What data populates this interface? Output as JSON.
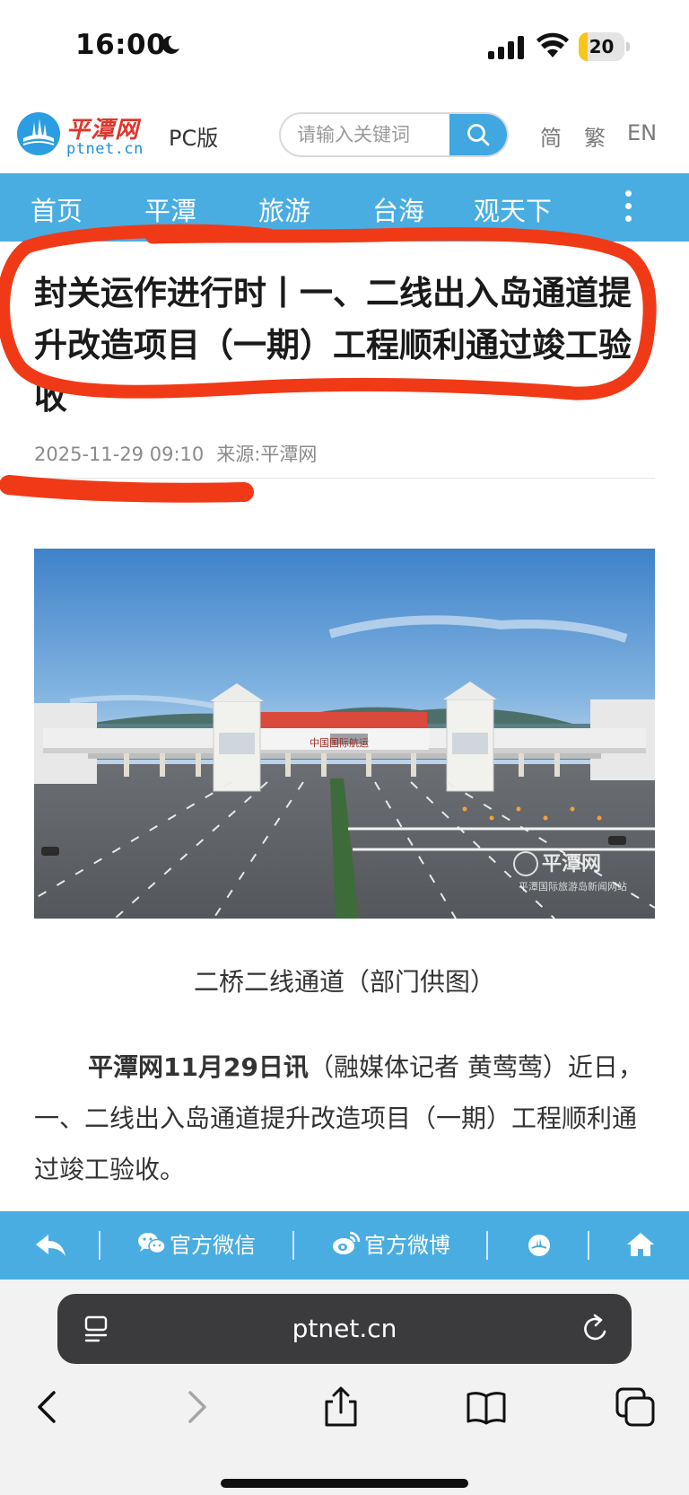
{
  "status_bar": {
    "time": "16:00",
    "battery": "20",
    "battery_level": 0.2
  },
  "header": {
    "logo_cn": "平潭网",
    "logo_en": "ptnet.cn",
    "pc_link": "PC版",
    "search_placeholder": "请输入关键词",
    "lang_simplified": "简",
    "lang_traditional": "繁",
    "lang_en": "EN"
  },
  "nav": {
    "items": [
      "首页",
      "平潭",
      "旅游",
      "台海",
      "观天下"
    ]
  },
  "article": {
    "title": "封关运作进行时丨一、二线出入岛通道提升改造项目（一期）工程顺利通过竣工验收",
    "date": "2025-11-29 09:10",
    "source": "来源:平潭网",
    "photo_sign": "中国国际航运",
    "photo_watermark_cn": "平潭网",
    "photo_watermark_sub": "平潭国际旅游岛新闻网站",
    "caption": "二桥二线通道（部门供图）",
    "lead": "平潭网11月29日讯",
    "body": "（融媒体记者 黄莺莺）近日，一、二线出入岛通道提升改造项目（一期）工程顺利通过竣工验收。"
  },
  "share_bar": {
    "wechat": "官方微信",
    "weibo": "官方微博"
  },
  "browser": {
    "url": "ptnet.cn"
  },
  "colors": {
    "brand_blue": "#49ade2",
    "logo_red": "#e0352b",
    "annotation_red": "#f03a17"
  }
}
